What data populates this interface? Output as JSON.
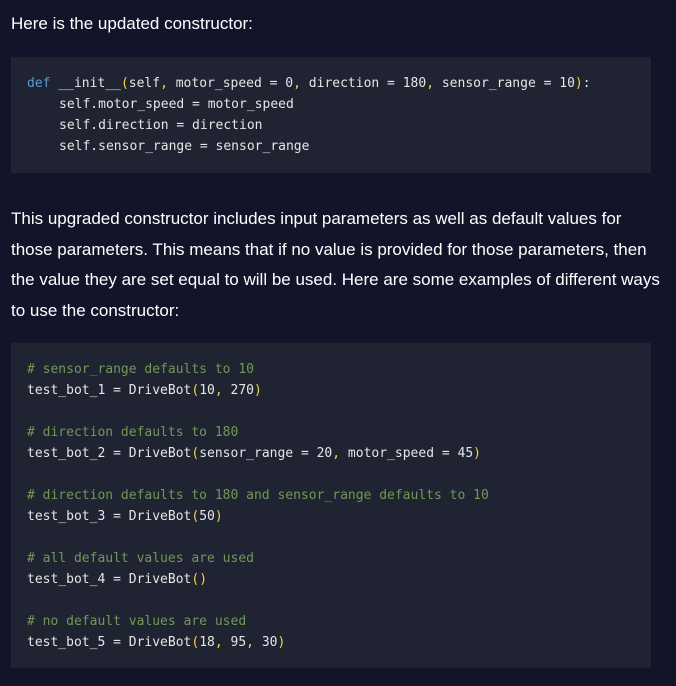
{
  "intro_text": "Here is the updated constructor:",
  "constructor_code": {
    "def_kw": "def",
    "sig_name": " __init__",
    "sig_open": "(",
    "sig_p1": "self",
    "sig_c1": ",",
    "sig_p2": " motor_speed = 0",
    "sig_c2": ",",
    "sig_p3": " direction = 180",
    "sig_c3": ",",
    "sig_p4": " sensor_range = 10",
    "sig_close": ")",
    "sig_colon": ":",
    "lines": [
      "self.motor_speed = motor_speed",
      "self.direction = direction",
      "self.sensor_range = sensor_range"
    ]
  },
  "paragraph": "This upgraded constructor includes input parameters as well as default values for those parameters. This means that if no value is provided for those parameters, then the value they are set equal to will be used. Here are some examples of different ways to use the constructor:",
  "examples": [
    {
      "comment": "# sensor_range defaults to 10",
      "prefix": "test_bot_1 = DriveBot",
      "args": [
        "10",
        "270"
      ]
    },
    {
      "comment": "# direction defaults to 180",
      "prefix": "test_bot_2 = DriveBot",
      "args": [
        "sensor_range = 20",
        "motor_speed = 45"
      ]
    },
    {
      "comment": "# direction defaults to 180 and sensor_range defaults to 10",
      "prefix": "test_bot_3 = DriveBot",
      "args": [
        "50"
      ]
    },
    {
      "comment": "# all default values are used",
      "prefix": "test_bot_4 = DriveBot",
      "args": []
    },
    {
      "comment": "# no default values are used",
      "prefix": "test_bot_5 = DriveBot",
      "args": [
        "18",
        "95",
        "30"
      ]
    }
  ],
  "colors": {
    "background": "#12152a",
    "code_background": "#202332",
    "keyword": "#569cd6",
    "comment": "#6f9955",
    "bracket": "#f2d548"
  }
}
